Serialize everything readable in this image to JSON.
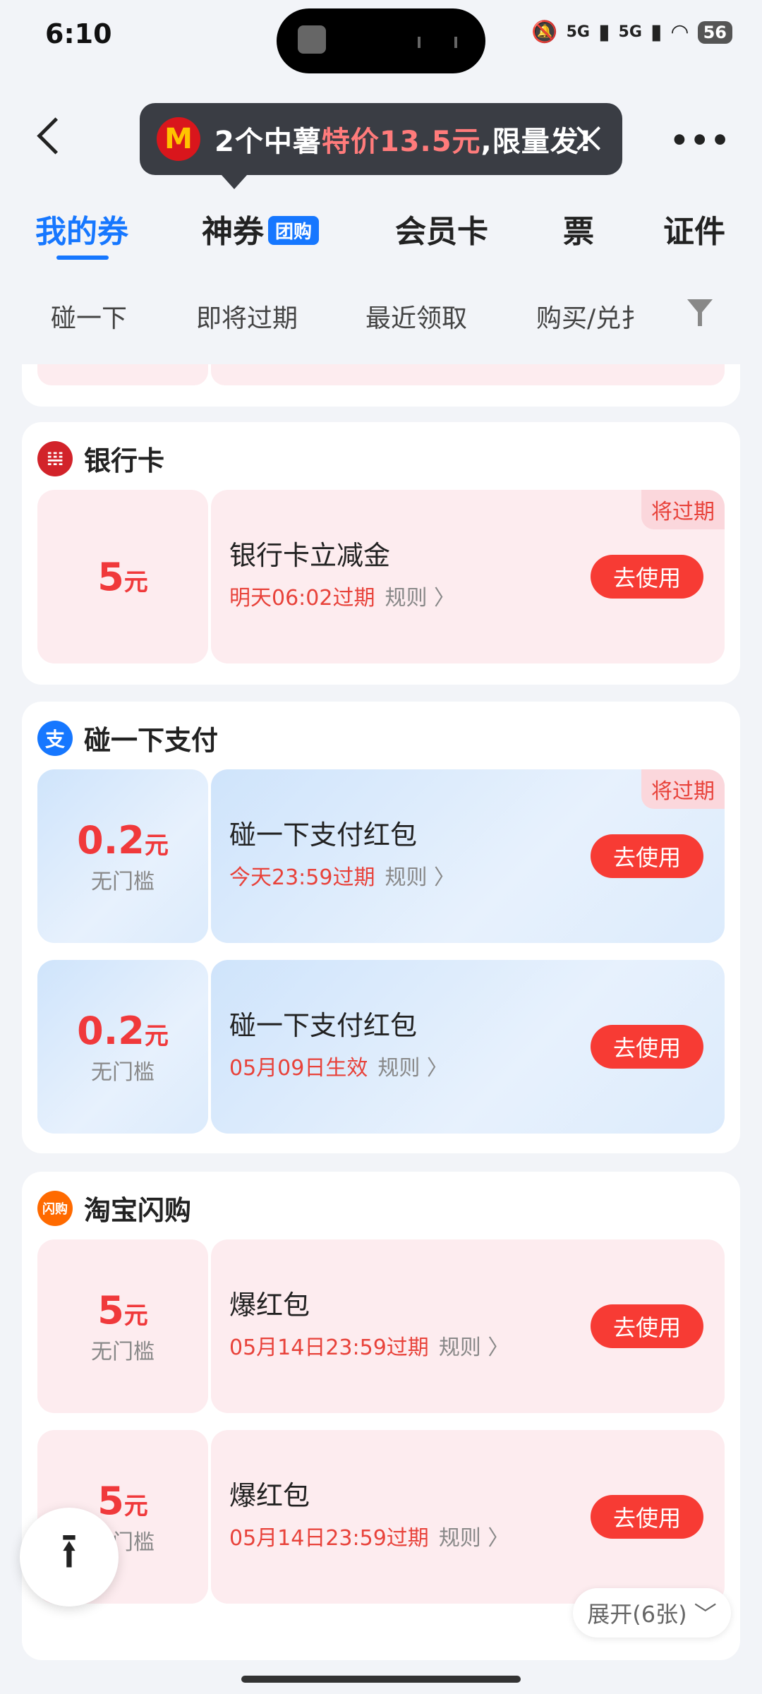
{
  "status_bar": {
    "time": "6:10",
    "signal1": "5G",
    "signal2": "5G",
    "battery": "56"
  },
  "banner": {
    "logo": "M",
    "text_before": "2个中薯",
    "text_highlight": "特价13.5元",
    "text_after": ",限量发!"
  },
  "tabs": [
    {
      "label": "我的券",
      "active": true
    },
    {
      "label": "神券",
      "badge": "团购"
    },
    {
      "label": "会员卡"
    },
    {
      "label": "票"
    },
    {
      "label": "证件"
    }
  ],
  "filters": [
    "碰一下",
    "即将过期",
    "最近领取",
    "购买/兑扌"
  ],
  "sections": {
    "bank": {
      "title": "银行卡",
      "icon": "bank-icon",
      "coupon": {
        "amount": "5",
        "unit": "元",
        "name": "银行卡立减金",
        "expiry": "明天06:02过期",
        "rule": "规则 〉",
        "button": "去使用",
        "tag": "将过期"
      }
    },
    "tap": {
      "title": "碰一下支付",
      "icon": "alipay-icon",
      "icon_char": "支",
      "coupons": [
        {
          "amount": "0.2",
          "unit": "元",
          "threshold": "无门槛",
          "name": "碰一下支付红包",
          "expiry": "今天23:59过期",
          "rule": "规则 〉",
          "button": "去使用",
          "tag": "将过期"
        },
        {
          "amount": "0.2",
          "unit": "元",
          "threshold": "无门槛",
          "name": "碰一下支付红包",
          "expiry": "05月09日生效",
          "rule": "规则 〉",
          "button": "去使用"
        }
      ]
    },
    "taobao": {
      "title": "淘宝闪购",
      "icon": "taobao-flash-icon",
      "icon_char": "闪购",
      "coupons": [
        {
          "amount": "5",
          "unit": "元",
          "threshold": "无门槛",
          "name": "爆红包",
          "expiry": "05月14日23:59过期",
          "rule": "规则 〉",
          "button": "去使用"
        },
        {
          "amount": "5",
          "unit": "元",
          "threshold": "无门槛",
          "name": "爆红包",
          "expiry": "05月14日23:59过期",
          "rule": "规则 〉",
          "button": "去使用"
        }
      ]
    }
  },
  "expand_label": "展开(6张) ﹀",
  "fab_icon": "⭱"
}
